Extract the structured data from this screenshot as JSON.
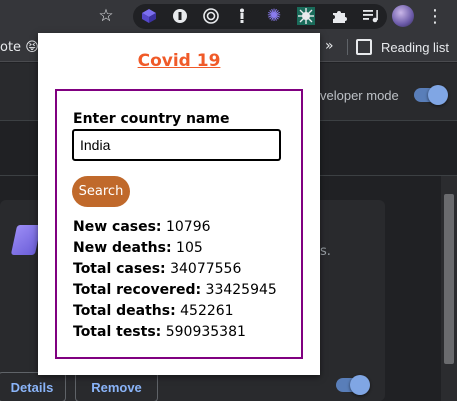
{
  "bookmarks": {
    "left_fragment": "ote",
    "left_emoji": "😝",
    "overflow": "»",
    "reading_list": "Reading list"
  },
  "page": {
    "developer_mode": "veloper mode",
    "card_desc": "s.",
    "details_btn": "Details",
    "remove_btn": "Remove"
  },
  "popup": {
    "title": "Covid 19",
    "prompt": "Enter country name",
    "input_value": "India",
    "search_button": "Search",
    "stats": [
      {
        "label": "New cases:",
        "value": "10796"
      },
      {
        "label": "New deaths:",
        "value": "105"
      },
      {
        "label": "Total cases:",
        "value": "34077556"
      },
      {
        "label": "Total recovered:",
        "value": "33425945"
      },
      {
        "label": "Total deaths:",
        "value": "452261"
      },
      {
        "label": "Total tests:",
        "value": "590935381"
      }
    ]
  },
  "toolbar": {
    "icons": [
      "star-icon",
      "extension-icon",
      "extension-icon",
      "extension-icon",
      "extension-icon",
      "extension-icon",
      "covid-extension-icon",
      "puzzle-icon",
      "media-icon",
      "avatar",
      "menu-icon"
    ]
  },
  "colors": {
    "title_orange": "#f05a28",
    "frame_purple": "#800080",
    "button_brown": "#c0692b",
    "accent_blue": "#8ab4f8"
  }
}
